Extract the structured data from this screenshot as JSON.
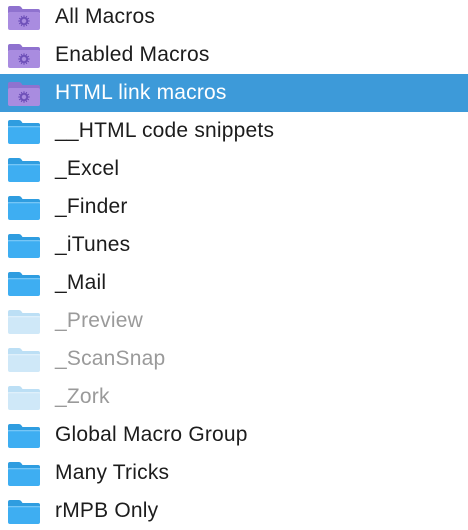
{
  "colors": {
    "selection": "#3d9ad9",
    "smart_folder": "#a98ce0",
    "folder": "#3eaef2",
    "folder_disabled": "#cfe8f8",
    "text": "#1c1c1c",
    "text_disabled": "#9a9a9a",
    "text_selected": "#ffffff"
  },
  "groups": [
    {
      "label": "All Macros",
      "icon": "smart-folder-icon",
      "state": "normal"
    },
    {
      "label": "Enabled Macros",
      "icon": "smart-folder-icon",
      "state": "normal"
    },
    {
      "label": "HTML link macros",
      "icon": "smart-folder-icon",
      "state": "selected"
    },
    {
      "label": "__HTML code snippets",
      "icon": "folder-icon",
      "state": "normal"
    },
    {
      "label": "_Excel",
      "icon": "folder-icon",
      "state": "normal"
    },
    {
      "label": "_Finder",
      "icon": "folder-icon",
      "state": "normal"
    },
    {
      "label": "_iTunes",
      "icon": "folder-icon",
      "state": "normal"
    },
    {
      "label": "_Mail",
      "icon": "folder-icon",
      "state": "normal"
    },
    {
      "label": "_Preview",
      "icon": "folder-icon",
      "state": "disabled"
    },
    {
      "label": "_ScanSnap",
      "icon": "folder-icon",
      "state": "disabled"
    },
    {
      "label": "_Zork",
      "icon": "folder-icon",
      "state": "disabled"
    },
    {
      "label": "Global Macro Group",
      "icon": "folder-icon",
      "state": "normal"
    },
    {
      "label": "Many Tricks",
      "icon": "folder-icon",
      "state": "normal"
    },
    {
      "label": "rMPB Only",
      "icon": "folder-icon",
      "state": "normal"
    }
  ]
}
